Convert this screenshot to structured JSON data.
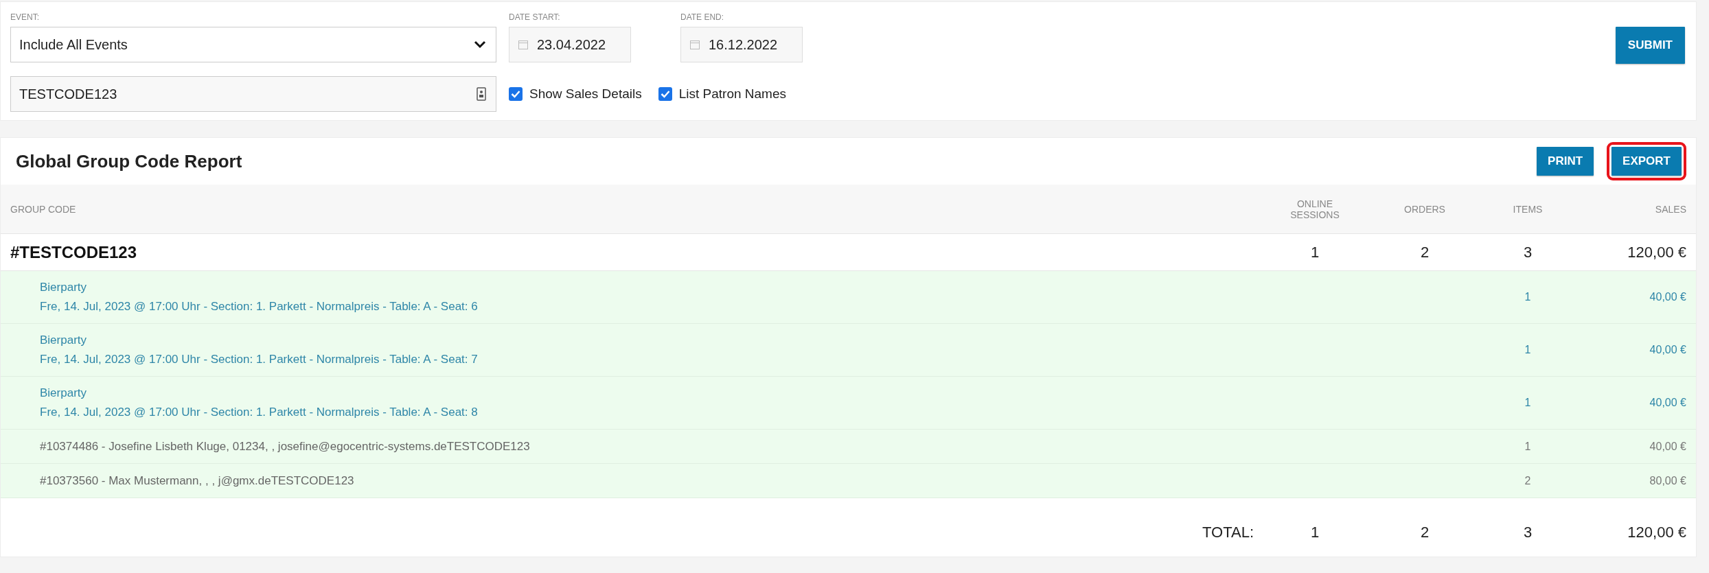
{
  "filters": {
    "event": {
      "label": "EVENT:",
      "value": "Include All Events"
    },
    "date_start": {
      "label": "DATE START:",
      "value": "23.04.2022"
    },
    "date_end": {
      "label": "DATE END:",
      "value": "16.12.2022"
    },
    "code": {
      "value": "TESTCODE123"
    },
    "checkboxes": [
      {
        "label": "Show Sales Details",
        "checked": true
      },
      {
        "label": "List Patron Names",
        "checked": true
      }
    ],
    "submit": "SUBMIT"
  },
  "report": {
    "title": "Global Group Code Report",
    "buttons": [
      {
        "label": "PRINT",
        "highlighted": false
      },
      {
        "label": "EXPORT",
        "highlighted": true
      }
    ],
    "columns": [
      "GROUP CODE",
      "ONLINE SESSIONS",
      "ORDERS",
      "ITEMS",
      "SALES"
    ],
    "group": {
      "code": "#TESTCODE123",
      "sessions": "1",
      "orders": "2",
      "items": "3",
      "sales": "120,00 €"
    },
    "rows": [
      {
        "kind": "ticket",
        "event": "Bierparty",
        "details": "Fre, 14. Jul, 2023 @ 17:00 Uhr - Section: 1. Parkett - Normalpreis - Table: A - Seat: 6",
        "items": "1",
        "sales": "40,00 €"
      },
      {
        "kind": "ticket",
        "event": "Bierparty",
        "details": "Fre, 14. Jul, 2023 @ 17:00 Uhr - Section: 1. Parkett - Normalpreis - Table: A - Seat: 7",
        "items": "1",
        "sales": "40,00 €"
      },
      {
        "kind": "ticket",
        "event": "Bierparty",
        "details": "Fre, 14. Jul, 2023 @ 17:00 Uhr - Section: 1. Parkett - Normalpreis - Table: A - Seat: 8",
        "items": "1",
        "sales": "40,00 €"
      },
      {
        "kind": "order",
        "text": "#10374486 - Josefine Lisbeth Kluge, 01234, , josefine@egocentric-systems.deTESTCODE123",
        "items": "1",
        "sales": "40,00 €"
      },
      {
        "kind": "order",
        "text": "#10373560 - Max Mustermann, , , j@gmx.deTESTCODE123",
        "items": "2",
        "sales": "80,00 €"
      }
    ],
    "total": {
      "label": "TOTAL:",
      "sessions": "1",
      "orders": "2",
      "items": "3",
      "sales": "120,00 €"
    }
  }
}
